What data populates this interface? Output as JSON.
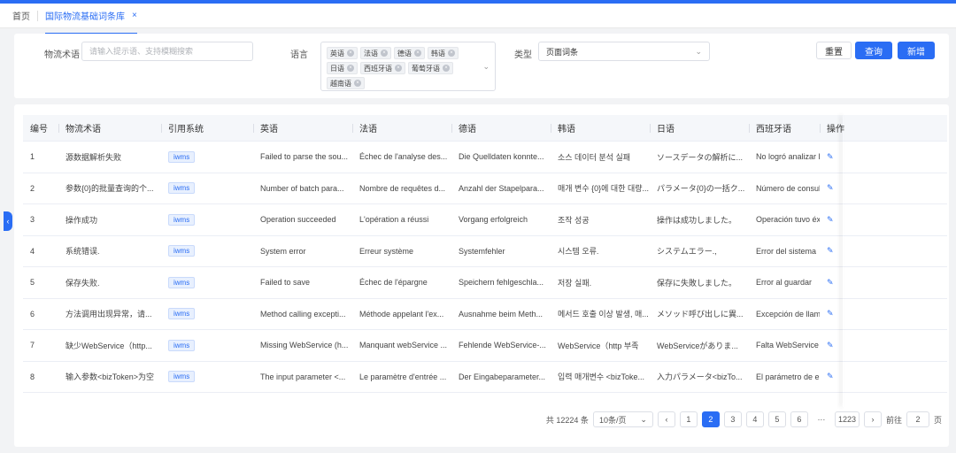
{
  "tabs": {
    "home": "首页",
    "active": "国际物流基础词条库",
    "close": "×"
  },
  "search": {
    "term_label": "物流术语",
    "term_placeholder": "请输入提示语、支持模糊搜索",
    "lang_label": "语言",
    "languages": [
      "英语",
      "法语",
      "德语",
      "韩语",
      "日语",
      "西班牙语",
      "葡萄牙语",
      "越南语"
    ],
    "type_label": "类型",
    "type_value": "页面词条",
    "reset": "重置",
    "query": "查询",
    "add": "新增"
  },
  "table": {
    "headers": [
      "编号",
      "物流术语",
      "引用系统",
      "英语",
      "法语",
      "德语",
      "韩语",
      "日语",
      "西班牙语",
      "操作"
    ],
    "rows": [
      [
        "1",
        "源数据解析失败",
        "iwms",
        "Failed to parse the sou...",
        "Échec de l'analyse des...",
        "Die Quelldaten konnte...",
        "소스 데이터 분석 실패",
        "ソースデータの解析に...",
        "No logró analizar lo"
      ],
      [
        "2",
        "参数{0}的批量查询的个...",
        "iwms",
        "Number of batch para...",
        "Nombre de requêtes d...",
        "Anzahl der Stapelpara...",
        "매개 변수 {0}에 대한 대량...",
        "パラメータ{0}の一括ク...",
        "Número de consult"
      ],
      [
        "3",
        "操作成功",
        "iwms",
        "Operation succeeded",
        "L'opération a réussi",
        "Vorgang erfolgreich",
        "조작 성공",
        "操作は成功しました。",
        "Operación tuvo éxit"
      ],
      [
        "4",
        "系统错误.",
        "iwms",
        "System error",
        "Erreur système",
        "Systemfehler",
        "시스템 오류.",
        "システムエラー.,",
        "Error del sistema"
      ],
      [
        "5",
        "保存失败.",
        "iwms",
        "Failed to save",
        "Échec de l'épargne",
        "Speichern fehlgeschla...",
        "저장 실패.",
        "保存に失敗しました。",
        "Error al guardar"
      ],
      [
        "6",
        "方法调用出现异常，请...",
        "iwms",
        "Method calling excepti...",
        "Méthode appelant l'ex...",
        "Ausnahme beim Meth...",
        "메서드 호출 이상 발생, 매...",
        "メソッド呼び出しに異...",
        "Excepción de llama"
      ],
      [
        "7",
        "缺少WebService（http...",
        "iwms",
        "Missing WebService (h...",
        "Manquant webService ...",
        "Fehlende WebService-...",
        "WebService（http 부족",
        "WebServiceがありま...",
        "Falta WebService (h"
      ],
      [
        "8",
        "输入参数<bizToken>为空",
        "iwms",
        "The input parameter <...",
        "Le paramètre d'entrée ...",
        "Der Eingabeparameter...",
        "입력 매개변수 <bizToke...",
        "入力パラメータ<bizTo...",
        "El parámetro de en"
      ]
    ],
    "edit_icon": "edit-icon"
  },
  "pager": {
    "total": "共 12224 条",
    "page_size": "10条/页",
    "pages": [
      "1",
      "2",
      "3",
      "4",
      "5",
      "6"
    ],
    "ellipsis": "···",
    "last": "1223",
    "current": "2",
    "goto_label": "前往",
    "goto_value": "2",
    "goto_suffix": "页"
  },
  "colors": {
    "primary": "#2a6df4"
  }
}
